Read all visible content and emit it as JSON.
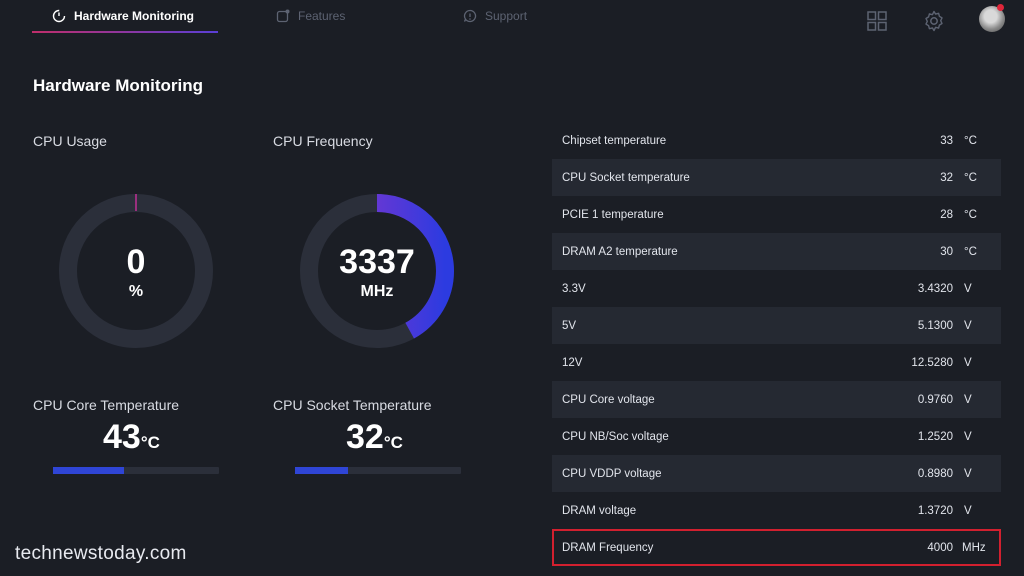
{
  "nav": {
    "tabs": [
      {
        "label": "Hardware Monitoring",
        "icon": "monitoring-icon",
        "active": true
      },
      {
        "label": "Features",
        "icon": "features-icon",
        "active": false
      },
      {
        "label": "Support",
        "icon": "support-icon",
        "active": false
      }
    ],
    "right_icons": [
      "grid-icon",
      "gear-icon",
      "avatar"
    ],
    "accent_gradient": [
      "#c02e6a",
      "#5a3fd6"
    ]
  },
  "page": {
    "title": "Hardware Monitoring"
  },
  "cpu_usage": {
    "label": "CPU Usage",
    "value": "0",
    "unit": "%",
    "fraction": 0.0
  },
  "cpu_frequency": {
    "label": "CPU Frequency",
    "value": "3337",
    "unit": "MHz",
    "fraction": 0.42
  },
  "cpu_core_temp": {
    "label": "CPU Core Temperature",
    "value": "43",
    "unit": "°C",
    "fraction": 0.43
  },
  "cpu_socket_temp": {
    "label": "CPU Socket Temperature",
    "value": "32",
    "unit": "°C",
    "fraction": 0.32
  },
  "sensors": [
    {
      "label": "Chipset temperature",
      "value": "33",
      "unit": "°C"
    },
    {
      "label": "CPU Socket temperature",
      "value": "32",
      "unit": "°C"
    },
    {
      "label": "PCIE 1 temperature",
      "value": "28",
      "unit": "°C"
    },
    {
      "label": "DRAM A2 temperature",
      "value": "30",
      "unit": "°C"
    },
    {
      "label": "3.3V",
      "value": "3.4320",
      "unit": "V"
    },
    {
      "label": "5V",
      "value": "5.1300",
      "unit": "V"
    },
    {
      "label": "12V",
      "value": "12.5280",
      "unit": "V"
    },
    {
      "label": "CPU Core voltage",
      "value": "0.9760",
      "unit": "V"
    },
    {
      "label": "CPU NB/Soc voltage",
      "value": "1.2520",
      "unit": "V"
    },
    {
      "label": "CPU VDDP voltage",
      "value": "0.8980",
      "unit": "V"
    },
    {
      "label": "DRAM voltage",
      "value": "1.3720",
      "unit": "V"
    },
    {
      "label": "DRAM Frequency",
      "value": "4000",
      "unit": "MHz"
    }
  ],
  "watermark": "technewstoday.com",
  "colors": {
    "background": "#1b1e25",
    "gauge_track": "#2b2f3a",
    "bar_fill": "#2f45d6",
    "highlight_box": "#d2202f"
  }
}
